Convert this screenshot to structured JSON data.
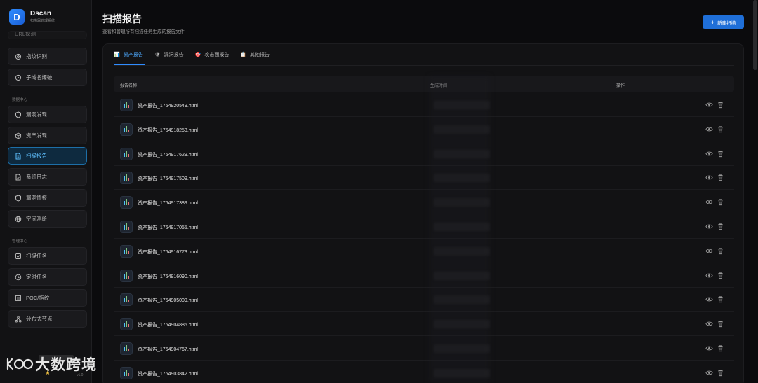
{
  "app": {
    "name": "Dscan",
    "subtitle": "扫描器管理系统",
    "logo_letter": "D"
  },
  "sidebar": {
    "partial_item": "URL探测",
    "top_items": [
      {
        "label": "指纹识别",
        "icon": "fingerprint-icon"
      },
      {
        "label": "子域名爆破",
        "icon": "target-icon"
      }
    ],
    "section_data": "数据中心",
    "data_items": [
      {
        "label": "漏洞发现",
        "icon": "shield-icon"
      },
      {
        "label": "资产发现",
        "icon": "cube-icon"
      },
      {
        "label": "扫描报告",
        "icon": "document-icon",
        "active": true
      },
      {
        "label": "系统日志",
        "icon": "log-icon"
      },
      {
        "label": "漏洞情报",
        "icon": "shield-outline-icon"
      },
      {
        "label": "空间测绘",
        "icon": "globe-icon"
      }
    ],
    "section_manage": "管理中心",
    "manage_items": [
      {
        "label": "扫描任务",
        "icon": "checkbox-icon"
      },
      {
        "label": "定时任务",
        "icon": "clock-icon"
      },
      {
        "label": "POC/指纹",
        "icon": "list-icon"
      },
      {
        "label": "分布式节点",
        "icon": "nodes-icon"
      }
    ],
    "version": "v1.0"
  },
  "header": {
    "title": "扫描报告",
    "subtitle": "查看和管理所有扫描任务生成的报告文件",
    "new_scan_label": "新建扫描"
  },
  "tabs": [
    {
      "label": "资产报告",
      "icon": "chart-icon",
      "glyph": "📊",
      "active": true
    },
    {
      "label": "漏洞报告",
      "icon": "shield-icon",
      "glyph": "🛡"
    },
    {
      "label": "攻击面报告",
      "icon": "target-icon",
      "glyph": "🎯"
    },
    {
      "label": "其他报告",
      "icon": "memo-icon",
      "glyph": "📋"
    }
  ],
  "table": {
    "columns": [
      "报告名称",
      "生成时间",
      "操作"
    ],
    "rows": [
      "资产报告_1764920549.html",
      "资产报告_1764918253.html",
      "资产报告_1764917629.html",
      "资产报告_1764917509.html",
      "资产报告_1764917389.html",
      "资产报告_1764917055.html",
      "资产报告_1764916773.html",
      "资产报告_1764916090.html",
      "资产报告_1764905009.html",
      "资产报告_1764904885.html",
      "资产报告_1764904767.html",
      "资产报告_1764903842.html"
    ]
  },
  "watermark": {
    "text": "大数跨境"
  },
  "colors": {
    "accent": "#2f8cff",
    "active_bg": "#0e2a3f",
    "active_text": "#5fc0ff",
    "background": "#0b0b0d"
  }
}
